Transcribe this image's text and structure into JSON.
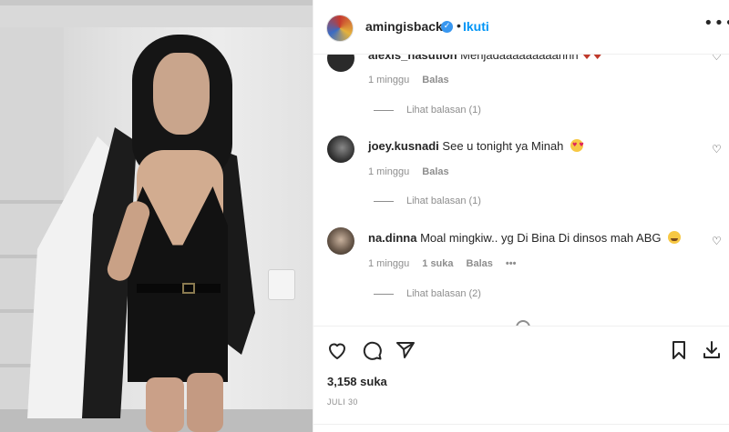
{
  "post": {
    "username": "amingisback",
    "follow_label": "Ikuti",
    "more_label": "•••"
  },
  "comments": [
    {
      "username": "alexis_nasution",
      "text": "Menjadaaaaaaaaahhh",
      "emoji": "heart-emoji",
      "time": "1 minggu",
      "reply_label": "Balas",
      "view_replies": "Lihat balasan (1)"
    },
    {
      "username": "joey.kusnadi",
      "text": "See u tonight ya Minah",
      "emoji": "heart-eyes-emoji",
      "time": "1 minggu",
      "reply_label": "Balas",
      "view_replies": "Lihat balasan (1)"
    },
    {
      "username": "na.dinna",
      "text": "Moal mingkiw.. yg Di Bina Di dinsos mah ABG",
      "emoji": "crying-laughing-emoji",
      "time": "1 minggu",
      "likes": "1 suka",
      "reply_label": "Balas",
      "options_label": "•••",
      "view_replies": "Lihat balasan (2)"
    }
  ],
  "footer": {
    "likes": "3,158 suka",
    "date": "JULI 30"
  },
  "icons": {
    "like": "heart-outline-icon",
    "comment": "speech-bubble-icon",
    "share": "paper-plane-icon",
    "save": "bookmark-icon",
    "download": "download-icon"
  },
  "colors": {
    "follow": "#0095f6",
    "text": "#262626",
    "muted": "#8e8e8e"
  }
}
